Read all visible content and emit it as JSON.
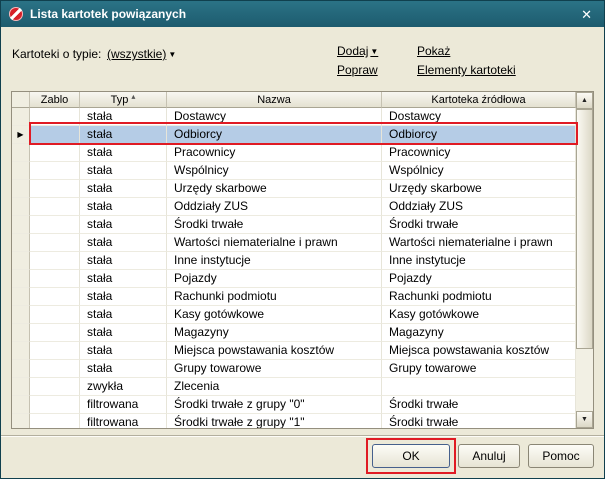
{
  "window": {
    "title": "Lista kartotek powiązanych",
    "close_glyph": "✕"
  },
  "toolbar": {
    "filter_label": "Kartoteki o typie:",
    "filter_value": "(wszystkie)",
    "links": {
      "dodaj": "Dodaj",
      "pokaz": "Pokaż",
      "popraw": "Popraw",
      "elementy": "Elementy kartoteki"
    }
  },
  "grid": {
    "columns": {
      "zablo": "Zablo",
      "typ": "Typ",
      "nazwa": "Nazwa",
      "zrodlo": "Kartoteka źródłowa"
    },
    "sort_glyph": "▴",
    "marker_glyph": "▶",
    "selected_index": 1,
    "rows": [
      [
        "stała",
        "Dostawcy",
        "Dostawcy"
      ],
      [
        "stała",
        "Odbiorcy",
        "Odbiorcy"
      ],
      [
        "stała",
        "Pracownicy",
        "Pracownicy"
      ],
      [
        "stała",
        "Wspólnicy",
        "Wspólnicy"
      ],
      [
        "stała",
        "Urzędy skarbowe",
        "Urzędy skarbowe"
      ],
      [
        "stała",
        "Oddziały ZUS",
        "Oddziały ZUS"
      ],
      [
        "stała",
        "Środki trwałe",
        "Środki trwałe"
      ],
      [
        "stała",
        "Wartości niematerialne i prawn",
        "Wartości niematerialne i prawn"
      ],
      [
        "stała",
        "Inne instytucje",
        "Inne instytucje"
      ],
      [
        "stała",
        "Pojazdy",
        "Pojazdy"
      ],
      [
        "stała",
        "Rachunki podmiotu",
        "Rachunki podmiotu"
      ],
      [
        "stała",
        "Kasy gotówkowe",
        "Kasy gotówkowe"
      ],
      [
        "stała",
        "Magazyny",
        "Magazyny"
      ],
      [
        "stała",
        "Miejsca powstawania kosztów",
        "Miejsca powstawania kosztów"
      ],
      [
        "stała",
        "Grupy towarowe",
        "Grupy towarowe"
      ],
      [
        "zwykła",
        "Zlecenia",
        ""
      ],
      [
        "filtrowana",
        "Środki trwałe z grupy \"0\"",
        "Środki trwałe"
      ],
      [
        "filtrowana",
        "Środki trwałe z grupy \"1\"",
        "Środki trwałe"
      ]
    ]
  },
  "buttons": {
    "ok": "OK",
    "cancel": "Anuluj",
    "help": "Pomoc"
  },
  "colors": {
    "titlebar": "#1d5b6e",
    "selection": "#b5cce6",
    "annotation": "#e01b24"
  }
}
